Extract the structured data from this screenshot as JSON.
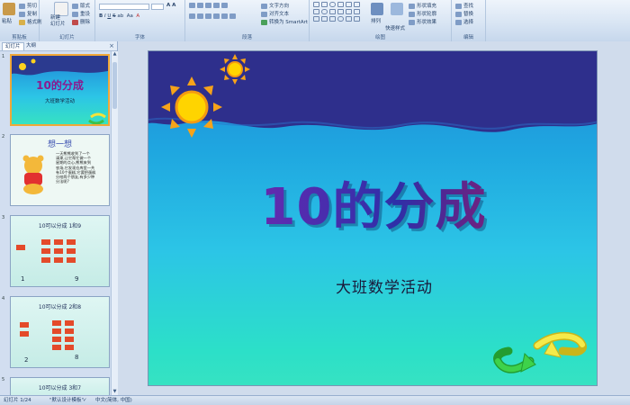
{
  "ribbon": {
    "clipboard": {
      "paste": "粘贴",
      "cut": "剪切",
      "copy": "复制",
      "format_painter": "格式刷",
      "label": "剪贴板"
    },
    "slides": {
      "new_slide": "新建\n幻灯片",
      "layout": "版式",
      "reset": "重设",
      "delete": "删除",
      "label": "幻灯片"
    },
    "font": {
      "label": "字体"
    },
    "paragraph": {
      "text_direction": "文字方向",
      "align_text": "对齐文本",
      "convert_smartart": "转换为 SmartArt",
      "label": "段落"
    },
    "drawing": {
      "arrange": "排列",
      "quick_styles": "快速样式",
      "shape_fill": "形状填充",
      "shape_outline": "形状轮廓",
      "shape_effects": "形状效果",
      "label": "绘图"
    },
    "editing": {
      "find": "查找",
      "replace": "替换",
      "select": "选择",
      "label": "编辑"
    }
  },
  "pane": {
    "tabs": [
      "幻灯片",
      "大纲"
    ],
    "close": "×",
    "thumbnails": [
      {
        "num": "1",
        "title": "10的分成",
        "subtitle": "大班数学活动"
      },
      {
        "num": "2",
        "title": "想一想",
        "body": "一天熊熊收到了一个\n请柬,让它帮忙做一个\n星期的点心,熊熊来到\n农场,它发现仓库里一共\n有10个蛋糕,它要把蛋糕\n分给两个朋友,有多少种\n分法呢?"
      },
      {
        "num": "3",
        "title": "10可以分成 1和9",
        "left": "1",
        "right": "9"
      },
      {
        "num": "4",
        "title": "10可以分成 2和8",
        "left": "2",
        "right": "8"
      },
      {
        "num": "5",
        "title": "10可以分成 3和7"
      }
    ]
  },
  "slide": {
    "title": "10的分成",
    "subtitle": "大班数学活动"
  },
  "status": {
    "slide_count": "幻灯片 1/24",
    "theme": "\"默认设计模板\"",
    "language": "中文(简体, 中国)"
  },
  "colors": {
    "ribbon": "#d7e4f3",
    "selection": "#f0a838",
    "title_start": "#9b1b9a",
    "title_end": "#c0124f"
  }
}
